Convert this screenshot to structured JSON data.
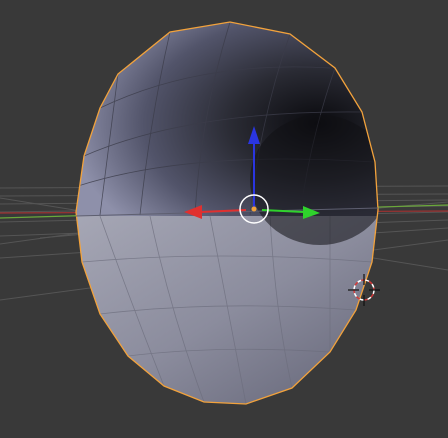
{
  "app": {
    "name": "3D View",
    "mode": "object-selected"
  },
  "viewport": {
    "background_color": "#393939",
    "grid_line_color": "#5a5a5a",
    "x_axis_color": "#b23a3a",
    "y_axis_color": "#7fbf3f"
  },
  "object": {
    "shape": "hemisphere-mesh",
    "outline_color": "#f2a23c",
    "face_colors": {
      "light": "#8f91aa",
      "mid": "#6c6e86",
      "dark": "#2b2c36",
      "lower_light": "#a4a5b3",
      "lower_mid": "#7c7d8f"
    }
  },
  "gizmo": {
    "x_arrow_color": "#e0302f",
    "y_arrow_color": "#2fd22c",
    "z_arrow_color": "#2a35e0",
    "origin_dot_color": "#f2a23c",
    "ring_color": "#ffffff"
  },
  "cursor_3d": {
    "ring_primary": "#d23a3a",
    "ring_secondary": "#ffffff",
    "crosshair_color": "#111111"
  }
}
